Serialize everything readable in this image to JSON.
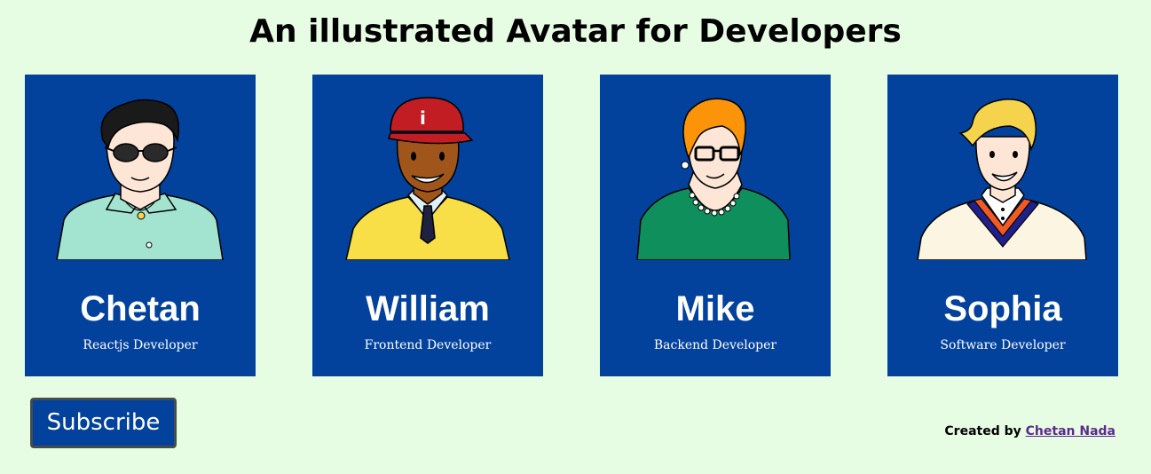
{
  "page": {
    "title": "An illustrated Avatar for Developers"
  },
  "cards": [
    {
      "name": "Chetan",
      "role": "Reactjs Developer",
      "icon": "male-developer-sunglasses-avatar",
      "accent": "#a3e4d0"
    },
    {
      "name": "William",
      "role": "Frontend Developer",
      "icon": "male-developer-red-cap-avatar",
      "accent": "#f8de47"
    },
    {
      "name": "Mike",
      "role": "Backend Developer",
      "icon": "female-developer-glasses-pearls-avatar",
      "accent": "#0f8f5c"
    },
    {
      "name": "Sophia",
      "role": "Software Developer",
      "icon": "male-developer-blonde-sweater-avatar",
      "accent": "#fbf5e2"
    }
  ],
  "colors": {
    "background": "#e7fde3",
    "card": "#02419c",
    "link": "#5c2a8c"
  },
  "subscribe": {
    "label": "Subscribe"
  },
  "footer": {
    "prefix": "Created by",
    "author_link": "Chetan Nada"
  }
}
